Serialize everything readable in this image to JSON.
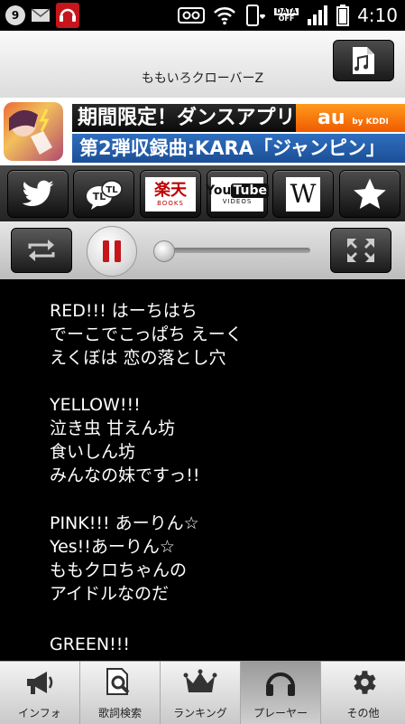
{
  "status_bar": {
    "notification_count": "9",
    "data_label_top": "DATA",
    "data_label_bottom": "OFF",
    "time": "4:10"
  },
  "title_bar": {
    "title": "ももいろクローバーZ"
  },
  "ad": {
    "line1": "期間限定！ダンスアプリ",
    "brand": "au",
    "brand_sub": "by KDDI",
    "line2": "第2弾収録曲:KARA「ジャンピン」"
  },
  "share_buttons": [
    "twitter-icon",
    "tl-icon",
    "rakuten-icon",
    "youtube-icon",
    "wikipedia-icon",
    "star-icon"
  ],
  "share_labels": {
    "rakuten": "楽天",
    "rakuten_sub": "BOOKS",
    "youtube_a": "You",
    "youtube_b": "Tube",
    "youtube_sub": "VIDEOS",
    "wiki": "W",
    "tl": "TL"
  },
  "player": {
    "progress": 0.0
  },
  "lyrics": [
    [
      "RED!!! はーちはち",
      "でーこでこっぱち えーく",
      "えくぼは 恋の落とし穴"
    ],
    [
      "YELLOW!!!",
      "泣き虫 甘えん坊",
      "食いしん坊",
      "みんなの妹ですっ!!"
    ],
    [
      "PINK!!! あーりん☆",
      "Yes!!あーりん☆",
      "ももクロちゃんの",
      "アイドルなのだ"
    ],
    [
      "GREEN!!!"
    ]
  ],
  "bottom_nav": [
    {
      "label": "インフォ",
      "icon": "megaphone-icon",
      "active": false
    },
    {
      "label": "歌詞検索",
      "icon": "lyrics-search-icon",
      "active": false
    },
    {
      "label": "ランキング",
      "icon": "crown-icon",
      "active": false
    },
    {
      "label": "プレーヤー",
      "icon": "headphones-icon",
      "active": true
    },
    {
      "label": "その他",
      "icon": "gear-icon",
      "active": false
    }
  ]
}
